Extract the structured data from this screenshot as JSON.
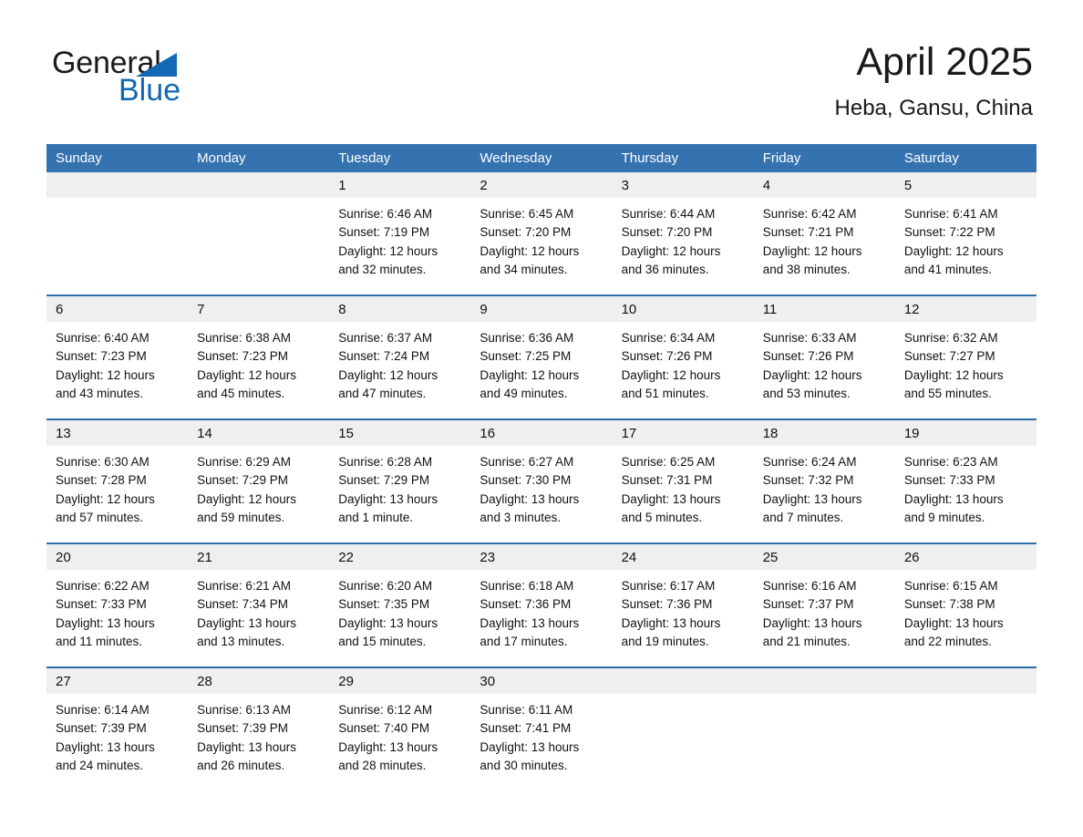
{
  "brand": {
    "name_part1": "General",
    "name_part2": "Blue",
    "triangle_color": "#1268b3",
    "text_color": "#1a1a1a"
  },
  "header": {
    "title": "April 2025",
    "subtitle": "Heba, Gansu, China"
  },
  "theme": {
    "header_bar_color": "#3572b0",
    "week_divider_color": "#2e6da4",
    "daynum_band_color": "#efefef",
    "page_background": "#ffffff",
    "text_color": "#111111"
  },
  "weekdays": [
    "Sunday",
    "Monday",
    "Tuesday",
    "Wednesday",
    "Thursday",
    "Friday",
    "Saturday"
  ],
  "weeks": [
    {
      "days": [
        {
          "num": "",
          "lines": []
        },
        {
          "num": "",
          "lines": []
        },
        {
          "num": "1",
          "lines": [
            "Sunrise: 6:46 AM",
            "Sunset: 7:19 PM",
            "Daylight: 12 hours",
            "and 32 minutes."
          ]
        },
        {
          "num": "2",
          "lines": [
            "Sunrise: 6:45 AM",
            "Sunset: 7:20 PM",
            "Daylight: 12 hours",
            "and 34 minutes."
          ]
        },
        {
          "num": "3",
          "lines": [
            "Sunrise: 6:44 AM",
            "Sunset: 7:20 PM",
            "Daylight: 12 hours",
            "and 36 minutes."
          ]
        },
        {
          "num": "4",
          "lines": [
            "Sunrise: 6:42 AM",
            "Sunset: 7:21 PM",
            "Daylight: 12 hours",
            "and 38 minutes."
          ]
        },
        {
          "num": "5",
          "lines": [
            "Sunrise: 6:41 AM",
            "Sunset: 7:22 PM",
            "Daylight: 12 hours",
            "and 41 minutes."
          ]
        }
      ]
    },
    {
      "days": [
        {
          "num": "6",
          "lines": [
            "Sunrise: 6:40 AM",
            "Sunset: 7:23 PM",
            "Daylight: 12 hours",
            "and 43 minutes."
          ]
        },
        {
          "num": "7",
          "lines": [
            "Sunrise: 6:38 AM",
            "Sunset: 7:23 PM",
            "Daylight: 12 hours",
            "and 45 minutes."
          ]
        },
        {
          "num": "8",
          "lines": [
            "Sunrise: 6:37 AM",
            "Sunset: 7:24 PM",
            "Daylight: 12 hours",
            "and 47 minutes."
          ]
        },
        {
          "num": "9",
          "lines": [
            "Sunrise: 6:36 AM",
            "Sunset: 7:25 PM",
            "Daylight: 12 hours",
            "and 49 minutes."
          ]
        },
        {
          "num": "10",
          "lines": [
            "Sunrise: 6:34 AM",
            "Sunset: 7:26 PM",
            "Daylight: 12 hours",
            "and 51 minutes."
          ]
        },
        {
          "num": "11",
          "lines": [
            "Sunrise: 6:33 AM",
            "Sunset: 7:26 PM",
            "Daylight: 12 hours",
            "and 53 minutes."
          ]
        },
        {
          "num": "12",
          "lines": [
            "Sunrise: 6:32 AM",
            "Sunset: 7:27 PM",
            "Daylight: 12 hours",
            "and 55 minutes."
          ]
        }
      ]
    },
    {
      "days": [
        {
          "num": "13",
          "lines": [
            "Sunrise: 6:30 AM",
            "Sunset: 7:28 PM",
            "Daylight: 12 hours",
            "and 57 minutes."
          ]
        },
        {
          "num": "14",
          "lines": [
            "Sunrise: 6:29 AM",
            "Sunset: 7:29 PM",
            "Daylight: 12 hours",
            "and 59 minutes."
          ]
        },
        {
          "num": "15",
          "lines": [
            "Sunrise: 6:28 AM",
            "Sunset: 7:29 PM",
            "Daylight: 13 hours",
            "and 1 minute."
          ]
        },
        {
          "num": "16",
          "lines": [
            "Sunrise: 6:27 AM",
            "Sunset: 7:30 PM",
            "Daylight: 13 hours",
            "and 3 minutes."
          ]
        },
        {
          "num": "17",
          "lines": [
            "Sunrise: 6:25 AM",
            "Sunset: 7:31 PM",
            "Daylight: 13 hours",
            "and 5 minutes."
          ]
        },
        {
          "num": "18",
          "lines": [
            "Sunrise: 6:24 AM",
            "Sunset: 7:32 PM",
            "Daylight: 13 hours",
            "and 7 minutes."
          ]
        },
        {
          "num": "19",
          "lines": [
            "Sunrise: 6:23 AM",
            "Sunset: 7:33 PM",
            "Daylight: 13 hours",
            "and 9 minutes."
          ]
        }
      ]
    },
    {
      "days": [
        {
          "num": "20",
          "lines": [
            "Sunrise: 6:22 AM",
            "Sunset: 7:33 PM",
            "Daylight: 13 hours",
            "and 11 minutes."
          ]
        },
        {
          "num": "21",
          "lines": [
            "Sunrise: 6:21 AM",
            "Sunset: 7:34 PM",
            "Daylight: 13 hours",
            "and 13 minutes."
          ]
        },
        {
          "num": "22",
          "lines": [
            "Sunrise: 6:20 AM",
            "Sunset: 7:35 PM",
            "Daylight: 13 hours",
            "and 15 minutes."
          ]
        },
        {
          "num": "23",
          "lines": [
            "Sunrise: 6:18 AM",
            "Sunset: 7:36 PM",
            "Daylight: 13 hours",
            "and 17 minutes."
          ]
        },
        {
          "num": "24",
          "lines": [
            "Sunrise: 6:17 AM",
            "Sunset: 7:36 PM",
            "Daylight: 13 hours",
            "and 19 minutes."
          ]
        },
        {
          "num": "25",
          "lines": [
            "Sunrise: 6:16 AM",
            "Sunset: 7:37 PM",
            "Daylight: 13 hours",
            "and 21 minutes."
          ]
        },
        {
          "num": "26",
          "lines": [
            "Sunrise: 6:15 AM",
            "Sunset: 7:38 PM",
            "Daylight: 13 hours",
            "and 22 minutes."
          ]
        }
      ]
    },
    {
      "days": [
        {
          "num": "27",
          "lines": [
            "Sunrise: 6:14 AM",
            "Sunset: 7:39 PM",
            "Daylight: 13 hours",
            "and 24 minutes."
          ]
        },
        {
          "num": "28",
          "lines": [
            "Sunrise: 6:13 AM",
            "Sunset: 7:39 PM",
            "Daylight: 13 hours",
            "and 26 minutes."
          ]
        },
        {
          "num": "29",
          "lines": [
            "Sunrise: 6:12 AM",
            "Sunset: 7:40 PM",
            "Daylight: 13 hours",
            "and 28 minutes."
          ]
        },
        {
          "num": "30",
          "lines": [
            "Sunrise: 6:11 AM",
            "Sunset: 7:41 PM",
            "Daylight: 13 hours",
            "and 30 minutes."
          ]
        },
        {
          "num": "",
          "lines": []
        },
        {
          "num": "",
          "lines": []
        },
        {
          "num": "",
          "lines": []
        }
      ]
    }
  ]
}
